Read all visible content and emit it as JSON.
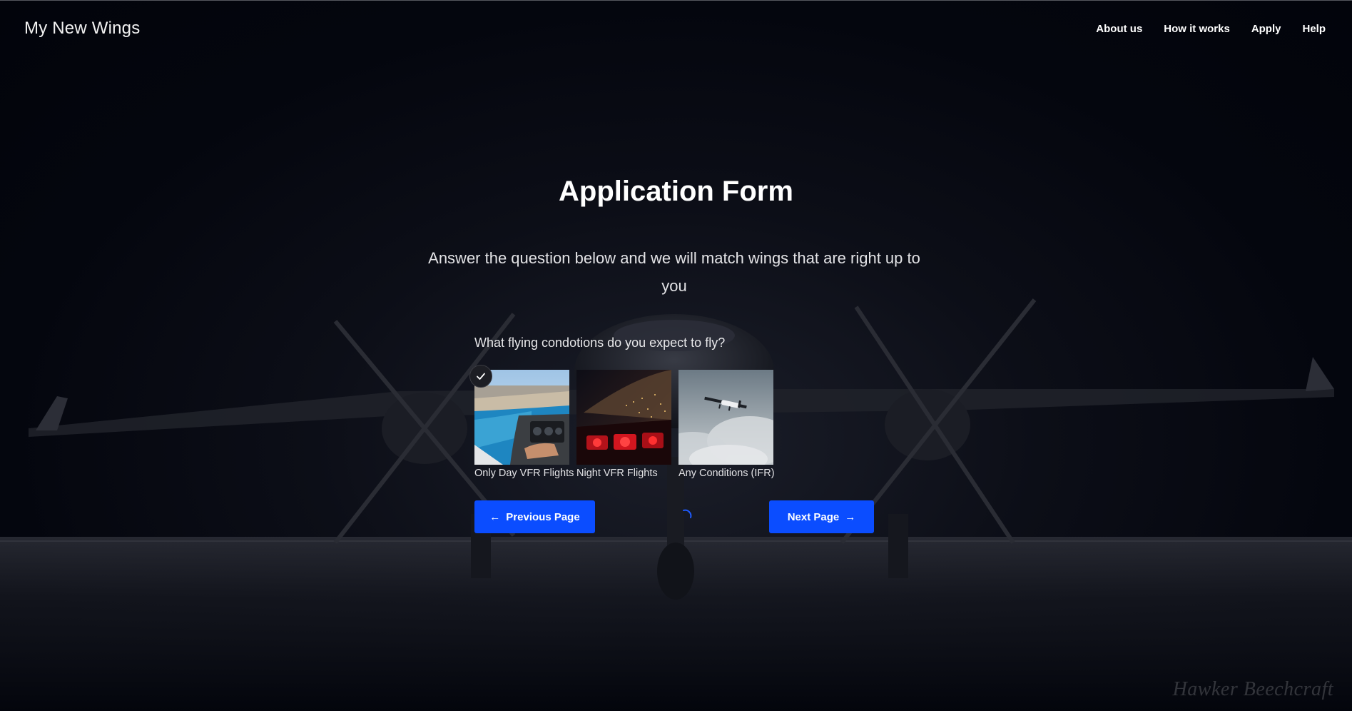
{
  "brand": "My New Wings",
  "nav": {
    "about": "About us",
    "how": "How it works",
    "apply": "Apply",
    "help": "Help"
  },
  "form": {
    "title": "Application Form",
    "subtitle": "Answer the question below and we will match wings that are right up to you",
    "question": "What flying condotions do you expect to fly?",
    "options": [
      {
        "label": "Only Day VFR Flights",
        "selected": true,
        "image": "day-vfr-coastline-cockpit"
      },
      {
        "label": "Night VFR Flights",
        "selected": false,
        "image": "night-cockpit-city-lights"
      },
      {
        "label": "Any Conditions (IFR)",
        "selected": false,
        "image": "small-plane-in-clouds"
      }
    ]
  },
  "buttons": {
    "prev": "Previous Page",
    "next": "Next Page",
    "prev_arrow": "←",
    "next_arrow": "→"
  },
  "watermark": "Hawker Beechcraft",
  "colors": {
    "accent": "#0b4dff",
    "background": "#03050d"
  }
}
